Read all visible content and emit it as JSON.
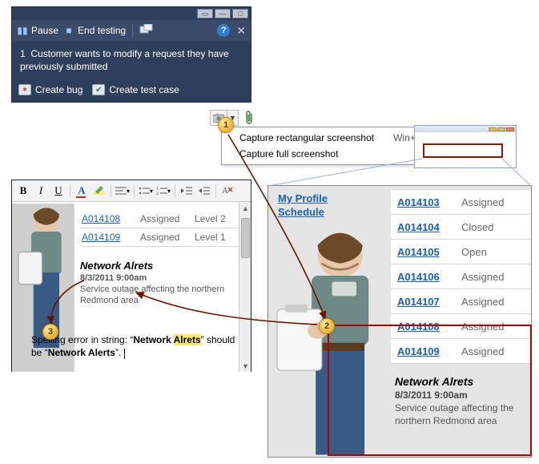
{
  "testRunner": {
    "pause": "Pause",
    "endTesting": "End testing",
    "stepNum": "1",
    "stepText": "Customer wants to modify a request they have previously submitted",
    "createBug": "Create bug",
    "createTestCase": "Create test case"
  },
  "captureMenu": {
    "items": [
      {
        "label": "Capture rectangular screenshot",
        "shortcut": "Win+Ctrl+C"
      },
      {
        "label": "Capture full screenshot",
        "shortcut": ""
      }
    ]
  },
  "badges": {
    "b1": "1",
    "b2": "2",
    "b3": "3"
  },
  "editor": {
    "rows": [
      {
        "id": "A014108",
        "status": "Assigned",
        "level": "Level 2"
      },
      {
        "id": "A014109",
        "status": "Assigned",
        "level": "Level 1"
      }
    ],
    "detail": {
      "title": "Network Alrets",
      "date": "8/3/2011 9:00am",
      "desc": "Service outage affecting the northern Redmond area"
    },
    "noteA": "Spelling error in string: “",
    "noteBad": "Network ",
    "noteBadHL": "Alrets",
    "noteB": "” should be “",
    "noteGood": "Network Alerts",
    "noteC": "”. "
  },
  "app": {
    "link1": "My Profile",
    "link2": "Schedule",
    "rows": [
      {
        "id": "A014103",
        "status": "Assigned"
      },
      {
        "id": "A014104",
        "status": "Closed"
      },
      {
        "id": "A014105",
        "status": "Open"
      },
      {
        "id": "A014106",
        "status": "Assigned"
      },
      {
        "id": "A014107",
        "status": "Assigned"
      },
      {
        "id": "A014108",
        "status": "Assigned"
      },
      {
        "id": "A014109",
        "status": "Assigned"
      }
    ],
    "detail": {
      "title": "Network Alrets",
      "date": "8/3/2011 9:00am",
      "desc": "Service outage affecting the northern Redmond area"
    }
  }
}
